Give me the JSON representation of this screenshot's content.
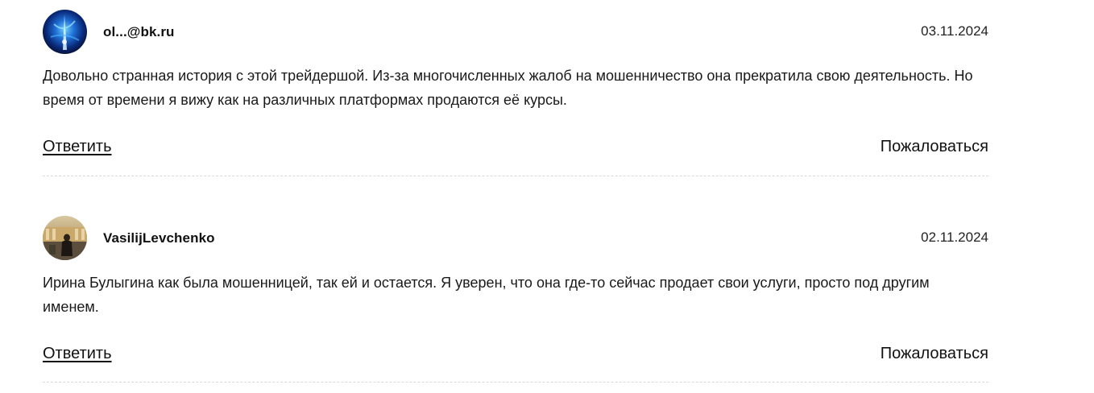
{
  "comments": [
    {
      "author": "ol...@bk.ru",
      "date": "03.11.2024",
      "text": "Довольно странная история с этой трейдершой. Из-за многочисленных жалоб на мошенничество она прекратила свою деятельность. Но время от времени я вижу как на различных платформах продаются её курсы.",
      "reply_label": "Ответить",
      "report_label": "Пожаловаться"
    },
    {
      "author": "VasilijLevchenko",
      "date": "02.11.2024",
      "text": "Ирина Булыгина как была мошенницей, так ей и остается. Я уверен, что она где-то сейчас продает свои услуги, просто под другим именем.",
      "reply_label": "Ответить",
      "report_label": "Пожаловаться"
    }
  ]
}
